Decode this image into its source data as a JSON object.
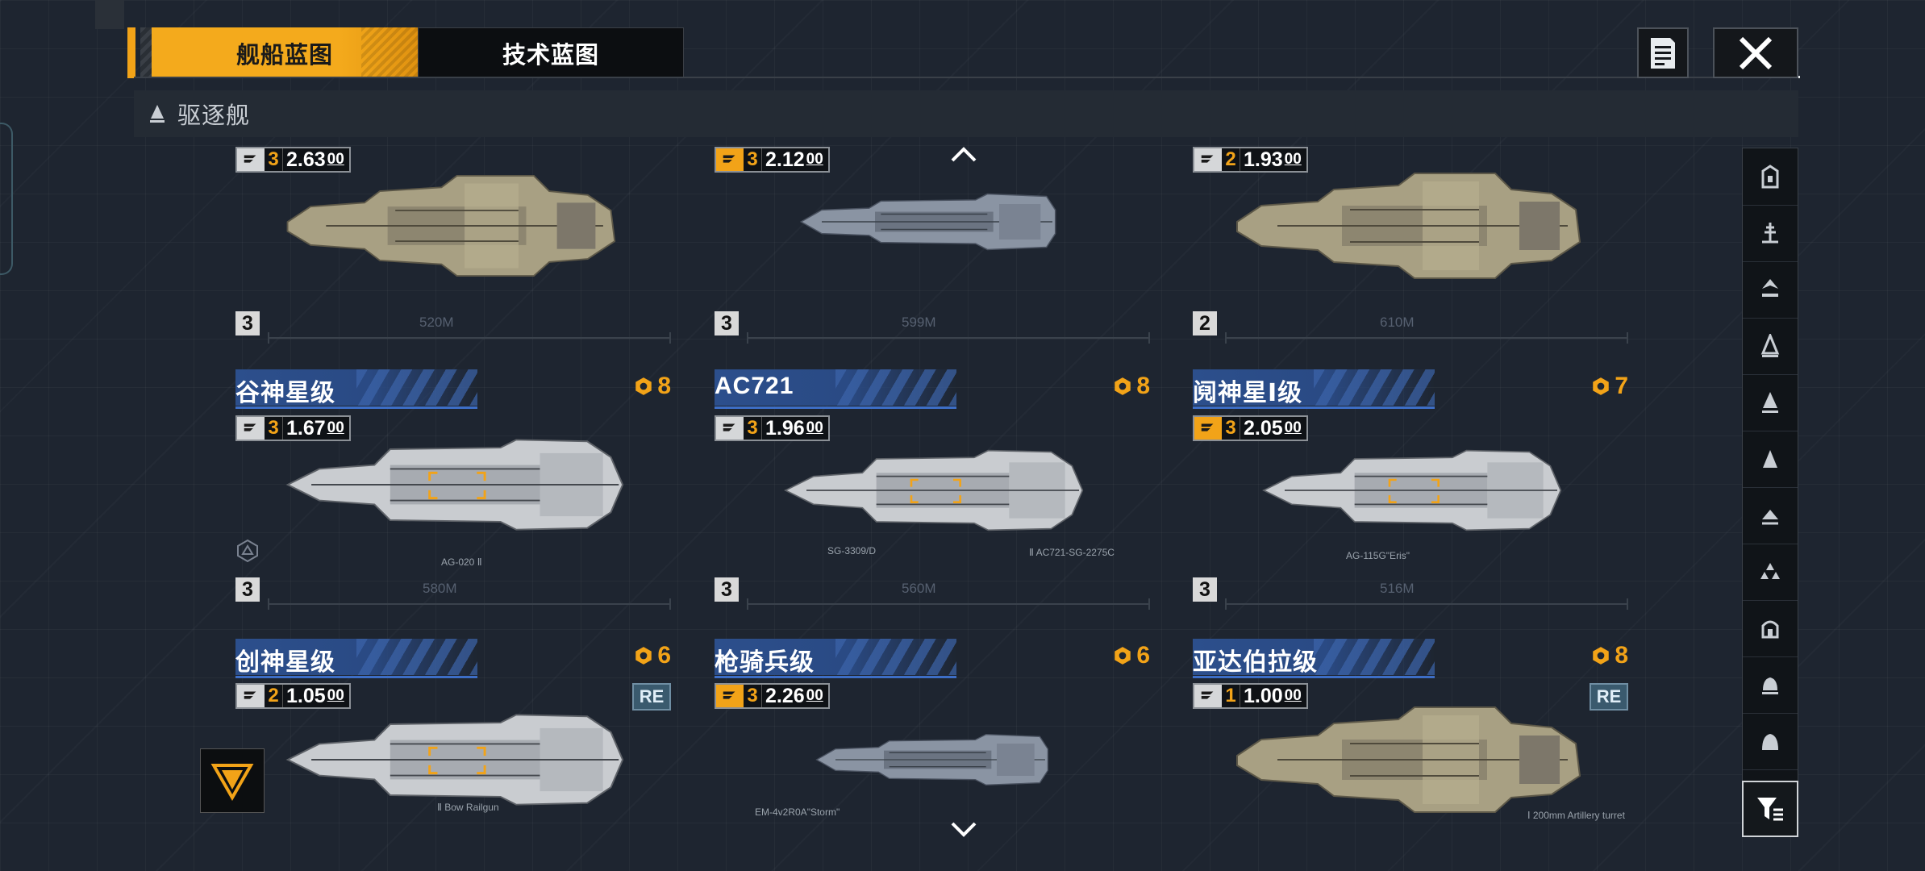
{
  "tabs": [
    {
      "label": "舰船蓝图",
      "active": true
    },
    {
      "label": "技术蓝图",
      "active": false
    }
  ],
  "category": {
    "label": "驱逐舰",
    "icon": "destroyer-icon"
  },
  "colors": {
    "accent": "#f2a318",
    "stripe": "#2c4f8c",
    "background": "#1e2530"
  },
  "ships": [
    {
      "name": "",
      "badge": "",
      "stat_level": "3",
      "stat_value": "2.63",
      "stat_suffix": "00",
      "tier": "3",
      "length": "520M",
      "weapon": "",
      "re": false,
      "hull": "tan"
    },
    {
      "name": "",
      "badge": "",
      "stat_level": "3",
      "stat_value": "2.12",
      "stat_suffix": "00",
      "tier": "3",
      "length": "599M",
      "weapon": "",
      "re": false,
      "hull": "grey"
    },
    {
      "name": "",
      "badge": "",
      "stat_level": "2",
      "stat_value": "1.93",
      "stat_suffix": "00",
      "tier": "2",
      "length": "610M",
      "weapon": "",
      "re": false,
      "hull": "tan"
    },
    {
      "name": "谷神星级",
      "badge": "8",
      "stat_level": "3",
      "stat_value": "1.67",
      "stat_suffix": "00",
      "tier": "3",
      "length": "580M",
      "weapon": "AG-020 Ⅱ",
      "re": false,
      "hull": "white"
    },
    {
      "name": "AC721",
      "badge": "8",
      "stat_level": "3",
      "stat_value": "1.96",
      "stat_suffix": "00",
      "tier": "3",
      "length": "560M",
      "weapon": "Ⅱ AC721-SG-2275C",
      "re": false,
      "hull": "white"
    },
    {
      "name": "阋神星Ⅰ级",
      "badge": "7",
      "stat_level": "3",
      "stat_value": "2.05",
      "stat_suffix": "00",
      "tier": "3",
      "length": "516M",
      "weapon": "AG-115G\"Eris\"",
      "re": false,
      "hull": "white"
    },
    {
      "name": "创神星级",
      "badge": "6",
      "stat_level": "2",
      "stat_value": "1.05",
      "stat_suffix": "00",
      "tier": "",
      "length": "",
      "weapon": "Ⅱ Bow Railgun",
      "re": true,
      "hull": "white"
    },
    {
      "name": "枪骑兵级",
      "badge": "6",
      "stat_level": "3",
      "stat_value": "2.26",
      "stat_suffix": "00",
      "tier": "",
      "length": "",
      "weapon": "EM-4v2R0A\"Storm\"",
      "re": false,
      "hull": "grey"
    },
    {
      "name": "亚达伯拉级",
      "badge": "8",
      "stat_level": "1",
      "stat_value": "1.00",
      "stat_suffix": "00",
      "tier": "",
      "length": "",
      "weapon": "Ⅰ 200mm Artillery turret",
      "re": true,
      "hull": "tan"
    }
  ],
  "re_label": "RE",
  "sidebar_icons": [
    "carrier-icon",
    "cruiser-icon",
    "battlecruiser-icon",
    "frigate-icon",
    "destroyer-icon",
    "corvette-icon",
    "aux-ship-icon",
    "fighter-icon",
    "station-icon",
    "shuttle-icon",
    "dome-icon"
  ],
  "extra_labels": {
    "sg_weapon": "SG-3309/D"
  }
}
